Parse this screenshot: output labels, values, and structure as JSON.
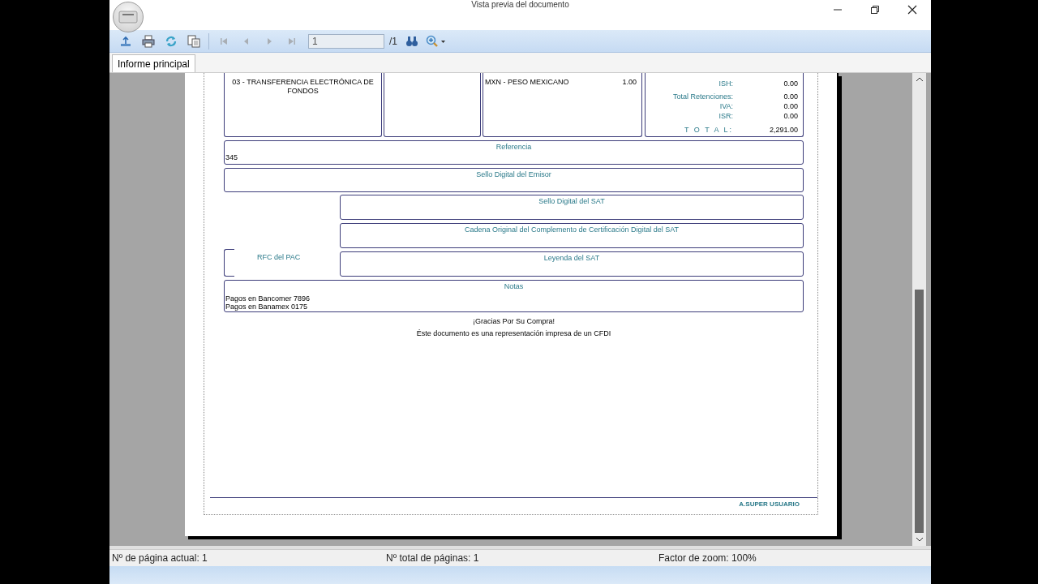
{
  "window": {
    "title": "Vista previa del documento"
  },
  "toolbar": {
    "buttons": [
      {
        "disabled": false
      },
      {
        "disabled": false
      },
      {
        "disabled": false
      },
      {
        "disabled": false
      },
      {
        "disabled": true
      },
      {
        "disabled": true
      },
      {
        "disabled": true
      },
      {
        "disabled": true
      }
    ],
    "page_field": {
      "value": "1"
    },
    "page_total": "/1"
  },
  "tabs": [
    {
      "label": "Informe principal",
      "selected": true
    }
  ],
  "report": {
    "payment_method": "03 - TRANSFERENCIA ELECTRÓNICA DE FONDOS",
    "currency": "MXN - PESO MEXICANO",
    "exchange_rate": "1.00",
    "totals": [
      {
        "label": "ISH:",
        "value": "0.00",
        "kind": "item"
      },
      {
        "label": "Total Retenciones:",
        "value": "0.00",
        "kind": "group"
      },
      {
        "label": "IVA:",
        "value": "0.00",
        "kind": "item"
      },
      {
        "label": "ISR:",
        "value": "0.00",
        "kind": "item"
      },
      {
        "label": "T O T A L:",
        "value": "2,291.00",
        "kind": "total"
      }
    ],
    "reference": {
      "title": "Referencia",
      "lines": [
        "345"
      ]
    },
    "emisor_seal": {
      "title": "Sello Digital del Emisor"
    },
    "pac_label": "RFC del PAC",
    "sat_boxes": [
      {
        "title": "Sello Digital del SAT"
      },
      {
        "title": "Cadena Original del Complemento de Certificación Digital del SAT"
      },
      {
        "title": "Leyenda del SAT"
      }
    ],
    "notes": {
      "title": "Notas",
      "lines": [
        "Pagos en Bancomer 7896",
        "Pagos en Banamex 0175"
      ]
    },
    "thanks": "¡Gracias Por Su Compra!",
    "disclaimer": "Éste documento es una representación impresa de un CFDI",
    "footer_user": "A.SUPER USUARIO"
  },
  "status_bar": [
    "Nº de página actual: 1",
    "Nº total de páginas: 1",
    "Factor de zoom: 100%"
  ]
}
